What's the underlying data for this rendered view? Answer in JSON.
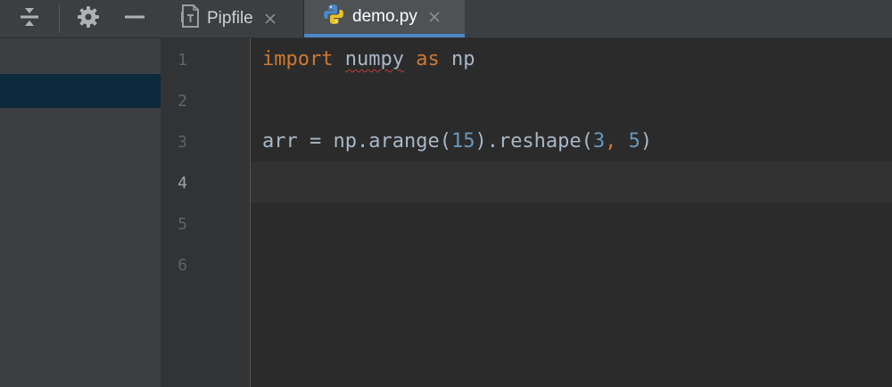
{
  "toolbar": {
    "icons": [
      "collapse-all-icon",
      "gear-icon",
      "minimize-icon"
    ]
  },
  "tabs": [
    {
      "label": "Pipfile",
      "icon": "pipfile-icon",
      "active": false
    },
    {
      "label": "demo.py",
      "icon": "python-icon",
      "active": true
    }
  ],
  "gutter": {
    "line_numbers": [
      "1",
      "2",
      "3",
      "4",
      "5",
      "6"
    ],
    "current_line": "4"
  },
  "code": {
    "line1": {
      "kw_import": "import",
      "module": "numpy",
      "kw_as": "as",
      "alias": "np"
    },
    "line3": {
      "var": "arr",
      "op": " = ",
      "call1": "np.arange(",
      "n15": "15",
      "call2": ").reshape(",
      "n3": "3",
      "comma": ", ",
      "n5": "5",
      "close": ")"
    }
  },
  "colors": {
    "keyword": "#cc7832",
    "number": "#6897bb",
    "default_text": "#a9b7c6",
    "tab_accent": "#4a88c7",
    "error_squiggle": "#bc3f3c"
  }
}
